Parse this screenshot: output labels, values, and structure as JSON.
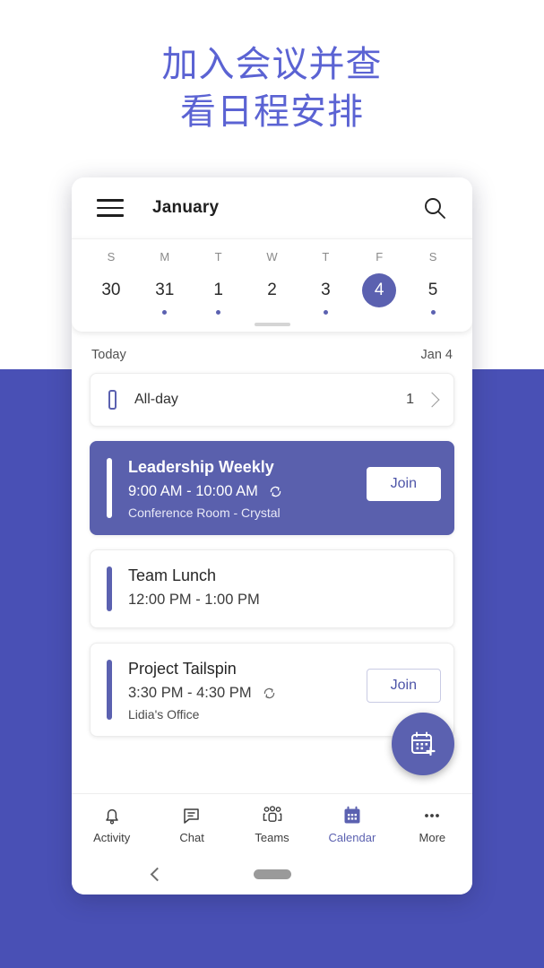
{
  "promo": {
    "headline": "加入会议并查\n看日程安排",
    "headline_color": "#5b63d3",
    "background_color": "#4950b5"
  },
  "appbar": {
    "menu_icon": "hamburger-menu-icon",
    "title": "January",
    "search_icon": "search-icon"
  },
  "calendar_strip": {
    "weekdays": [
      "S",
      "M",
      "T",
      "W",
      "T",
      "F",
      "S"
    ],
    "days": [
      {
        "date": "30",
        "has_event_dot": false,
        "selected": false
      },
      {
        "date": "31",
        "has_event_dot": true,
        "selected": false
      },
      {
        "date": "1",
        "has_event_dot": true,
        "selected": false
      },
      {
        "date": "2",
        "has_event_dot": false,
        "selected": false
      },
      {
        "date": "3",
        "has_event_dot": true,
        "selected": false
      },
      {
        "date": "4",
        "has_event_dot": false,
        "selected": true
      },
      {
        "date": "5",
        "has_event_dot": true,
        "selected": false
      }
    ],
    "selected_color": "#5b61b0",
    "drag_handle": "drag-handle"
  },
  "agenda": {
    "today_label": "Today",
    "today_date": "Jan 4",
    "allday": {
      "label": "All-day",
      "count": "1",
      "chevron_icon": "chevron-right-icon"
    },
    "events": [
      {
        "title": "Leadership Weekly",
        "time": "9:00 AM - 10:00 AM",
        "location": "Conference Room -  Crystal",
        "recurring": true,
        "recurring_icon": "recurring-icon",
        "join_label": "Join",
        "highlighted": true
      },
      {
        "title": "Team Lunch",
        "time": "12:00 PM - 1:00 PM",
        "location": "",
        "recurring": false,
        "recurring_icon": "recurring-icon",
        "join_label": "",
        "highlighted": false
      },
      {
        "title": "Project Tailspin",
        "time": "3:30 PM - 4:30 PM",
        "location": "Lidia's Office",
        "recurring": true,
        "recurring_icon": "recurring-icon",
        "join_label": "Join",
        "highlighted": false
      }
    ],
    "fab": {
      "icon": "calendar-add-icon",
      "color": "#5b61b0"
    }
  },
  "bottom_nav": {
    "items": [
      {
        "label": "Activity",
        "icon": "bell-icon",
        "active": false
      },
      {
        "label": "Chat",
        "icon": "chat-icon",
        "active": false
      },
      {
        "label": "Teams",
        "icon": "teams-icon",
        "active": false
      },
      {
        "label": "Calendar",
        "icon": "calendar-icon",
        "active": true
      },
      {
        "label": "More",
        "icon": "ellipsis-icon",
        "active": false
      }
    ],
    "active_color": "#5b61b0"
  },
  "system_bar": {
    "back_icon": "back-chevron-icon",
    "home_icon": "home-pill-icon"
  }
}
